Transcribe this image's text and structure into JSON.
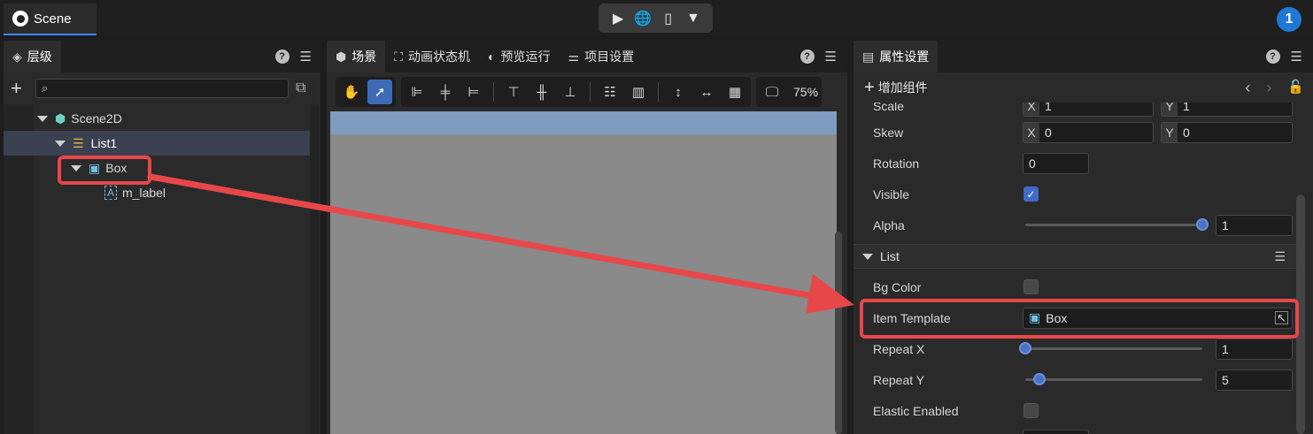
{
  "top": {
    "scene_tab": "Scene",
    "notification_count": "1"
  },
  "hierarchy": {
    "tab": "层级",
    "tree": [
      {
        "label": "Scene2D",
        "icon": "cube-icon",
        "level": 0
      },
      {
        "label": "List1",
        "icon": "list-icon",
        "level": 1
      },
      {
        "label": "Box",
        "icon": "box-icon",
        "level": 2
      },
      {
        "label": "m_label",
        "icon": "label-icon",
        "level": 3
      }
    ]
  },
  "scene": {
    "tabs": [
      "场景",
      "动画状态机",
      "预览运行",
      "项目设置"
    ],
    "zoom": "75%"
  },
  "props": {
    "tab": "属性设置",
    "add_component": "增加组件",
    "rows": {
      "scale_label": "Scale",
      "scale_x": "1",
      "scale_y": "1",
      "skew_label": "Skew",
      "skew_x": "0",
      "skew_y": "0",
      "rotation_label": "Rotation",
      "rotation": "0",
      "visible_label": "Visible",
      "alpha_label": "Alpha",
      "alpha": "1",
      "bgcolor_label": "Bg Color",
      "item_template_label": "Item Template",
      "item_template": "Box",
      "repeatx_label": "Repeat X",
      "repeat_x": "1",
      "repeaty_label": "Repeat Y",
      "repeat_y": "5",
      "elastic_label": "Elastic Enabled"
    },
    "section_list": "List",
    "axis_x": "X",
    "axis_y": "Y"
  },
  "values": {
    "alpha_fraction": 1.0,
    "repeat_x_fraction": 0.0,
    "repeat_y_fraction": 0.08,
    "visible_checked": true
  },
  "colors": {
    "accent": "#3a86ff",
    "highlight": "#e8474a",
    "selected_row": "#3b4150"
  }
}
